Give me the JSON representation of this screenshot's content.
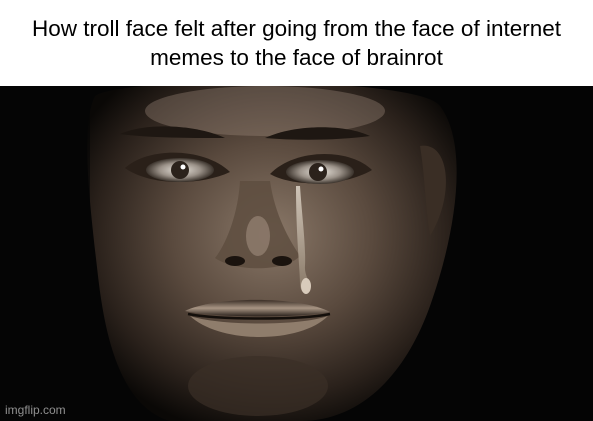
{
  "meme": {
    "caption": "How troll face felt after going from the face of internet memes to the face of brainrot"
  },
  "image": {
    "subject": "crying-man-face",
    "background_color": "#050505"
  },
  "watermark": {
    "text": "imgflip.com"
  }
}
